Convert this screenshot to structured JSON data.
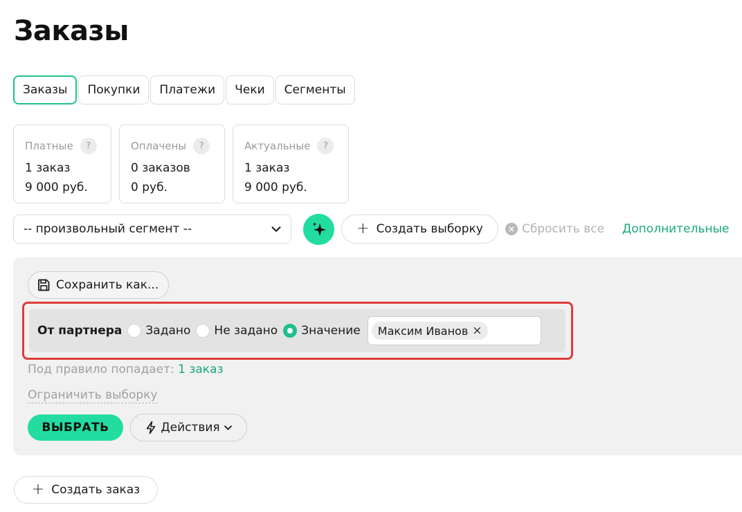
{
  "page": {
    "title": "Заказы"
  },
  "tabs": [
    {
      "label": "Заказы",
      "active": true
    },
    {
      "label": "Покупки"
    },
    {
      "label": "Платежи"
    },
    {
      "label": "Чеки"
    },
    {
      "label": "Сегменты"
    }
  ],
  "stats": [
    {
      "label": "Платные",
      "count": "1 заказ",
      "sum": "9 000 руб."
    },
    {
      "label": "Оплачены",
      "count": "0 заказов",
      "sum": "0 руб."
    },
    {
      "label": "Актуальные",
      "count": "1 заказ",
      "sum": "9 000 руб."
    }
  ],
  "help_mark": "?",
  "filters": {
    "segment_value": "-- произвольный сегмент --",
    "create_selection_label": "Создать выборку",
    "reset_label": "Сбросить все",
    "more_label": "Дополнительные"
  },
  "panel": {
    "save_as_label": "Сохранить как...",
    "rule": {
      "label": "От партнера",
      "options": [
        "Задано",
        "Не задано",
        "Значение"
      ],
      "selected": "Значение",
      "chip": "Максим Иванов"
    },
    "match_text": "Под правило попадает:",
    "match_link": "1 заказ",
    "limit_label": "Ограничить выборку",
    "select_label": "ВЫБРАТЬ",
    "actions_label": "Действия"
  },
  "create_order_label": "Создать заказ",
  "colors": {
    "accent": "#22dca0",
    "link": "#19a978",
    "highlight": "#e03b3b"
  }
}
